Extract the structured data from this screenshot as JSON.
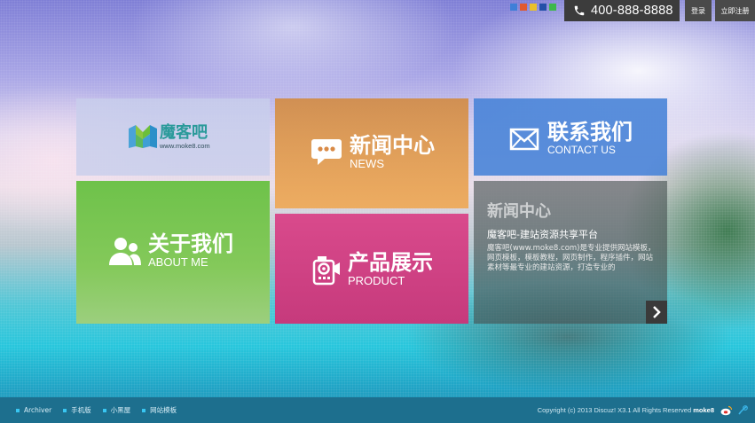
{
  "colors": {
    "swatches": [
      "#3f7fd8",
      "#e0592e",
      "#e9c02c",
      "#2450a8",
      "#3db84a"
    ],
    "accent_blue": "#4682d7",
    "footer": "#1d6f8e"
  },
  "header": {
    "phone": "400-888-8888",
    "login": "登录",
    "register": "立即注册"
  },
  "logo": {
    "name": "魔客吧",
    "url": "www.moke8.com"
  },
  "tiles": {
    "news": {
      "title": "新闻中心",
      "subtitle": "NEWS",
      "icon": "speech-bubble-icon"
    },
    "contact": {
      "title": "联系我们",
      "subtitle": "CONTACT US",
      "icon": "envelope-icon"
    },
    "about": {
      "title": "关于我们",
      "subtitle": "ABOUT ME",
      "icon": "users-icon"
    },
    "product": {
      "title": "产品展示",
      "subtitle": "PRODUCT",
      "icon": "camera-icon"
    }
  },
  "news_box": {
    "heading": "新闻中心",
    "subtitle": "魔客吧-建站资源共享平台",
    "text": "魔客吧(www.moke8.com)是专业提供网站模板，网页模板，模板教程，网页制作，程序插件，网站素材等最专业的建站资源，打造专业的",
    "arrow_icon": "chevron-right-icon"
  },
  "footer": {
    "links": [
      "Archiver",
      "手机版",
      "小黑屋",
      "网站模板"
    ],
    "copyright_prefix": "Copyright (c) 2013 Discuz! X3.1  All Rights Reserved",
    "copyright_brand": "moke8",
    "icons": [
      "weibo-icon",
      "tencent-weibo-icon"
    ]
  }
}
